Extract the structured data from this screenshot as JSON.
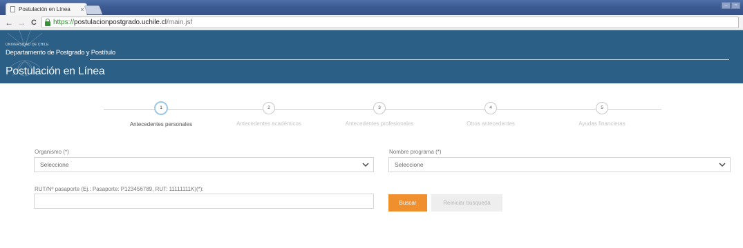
{
  "browser": {
    "tab_title": "Postulación en Línea",
    "tab_close": "×",
    "url_protocol": "https://",
    "url_host": "postulacionpostgrado.uchile.cl",
    "url_path": "/main.jsf",
    "back_icon": "←",
    "forward_icon": "→",
    "reload_icon": "C"
  },
  "header": {
    "university": "Universidad de Chile",
    "department": "Departamento de Postgrado y Postítulo",
    "system_title": "Postulación en Línea",
    "background_color": "#2b5f86"
  },
  "stepper": {
    "active_index": 1,
    "steps": [
      {
        "number": "1",
        "label": "Antecedentes personales"
      },
      {
        "number": "2",
        "label": "Antecedentes académicos"
      },
      {
        "number": "3",
        "label": "Antecedentes profesionales"
      },
      {
        "number": "4",
        "label": "Otros antecedentes"
      },
      {
        "number": "5",
        "label": "Ayudas financieras"
      }
    ]
  },
  "form": {
    "organismo": {
      "label": "Organismo (*)",
      "value": "Seleccione"
    },
    "programa": {
      "label": "Nombre programa (*)",
      "value": "Seleccione"
    },
    "rut": {
      "label": "RUT/Nº pasaporte (Ej.: Pasaporte: P123456789, RUT: 11111111K)(*):",
      "value": ""
    },
    "buscar_label": "Buscar",
    "reset_label": "Reiniciar búsqueda",
    "accent_color": "#ef8f2e"
  }
}
